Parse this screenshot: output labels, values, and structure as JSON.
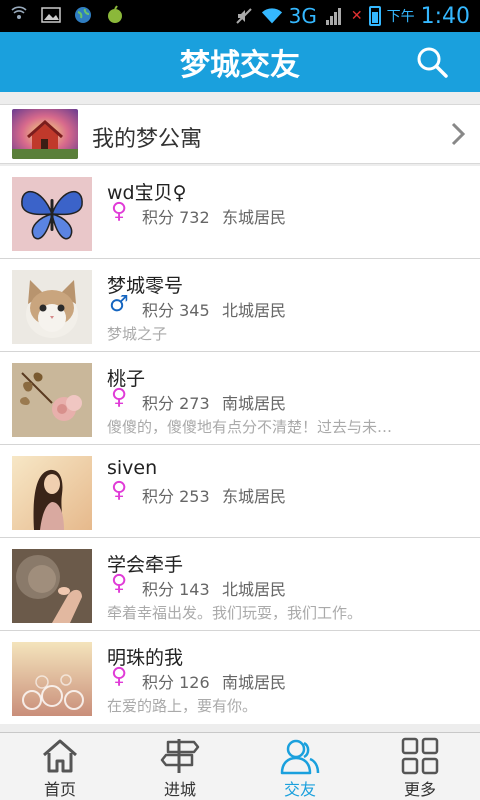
{
  "status_bar": {
    "network": "3G",
    "ampm": "下午",
    "time": "1:40",
    "icons": [
      "wifi-hotspot-icon",
      "image-icon",
      "globe-icon",
      "app-icon",
      "mute-icon",
      "wifi-icon",
      "signal-icon",
      "no-signal-icon",
      "battery-icon"
    ]
  },
  "header": {
    "title": "梦城交友",
    "search_icon": "search-icon"
  },
  "apartment": {
    "label": "我的梦公寓",
    "chevron_icon": "chevron-right-icon"
  },
  "friends": [
    {
      "name": "wd宝贝♀",
      "gender": "♀",
      "gender_type": "female",
      "score": "积分 732",
      "district": "东城居民",
      "bio": ""
    },
    {
      "name": "梦城零号",
      "gender": "♂",
      "gender_type": "male",
      "score": "积分 345",
      "district": "北城居民",
      "bio": "梦城之子"
    },
    {
      "name": "桃子",
      "gender": "♀",
      "gender_type": "female",
      "score": "积分 273",
      "district": "南城居民",
      "bio": "傻傻的，傻傻地有点分不清楚！过去与未…"
    },
    {
      "name": "siven",
      "gender": "♀",
      "gender_type": "female",
      "score": "积分 253",
      "district": "东城居民",
      "bio": ""
    },
    {
      "name": "学会牵手",
      "gender": "♀",
      "gender_type": "female",
      "score": "积分 143",
      "district": "北城居民",
      "bio": "牵着幸福出发。我们玩耍，我们工作。"
    },
    {
      "name": "明珠的我",
      "gender": "♀",
      "gender_type": "female",
      "score": "积分 126",
      "district": "南城居民",
      "bio": "在爱的路上，要有你。"
    }
  ],
  "bottom_nav": [
    {
      "label": "首页",
      "icon": "home-icon",
      "active": false
    },
    {
      "label": "进城",
      "icon": "signpost-icon",
      "active": false
    },
    {
      "label": "交友",
      "icon": "friends-icon",
      "active": true
    },
    {
      "label": "更多",
      "icon": "grid-icon",
      "active": false
    }
  ],
  "colors": {
    "header": "#1aa0dd",
    "accent": "#1aa0dd",
    "female": "#e03bd7",
    "male": "#1565c0",
    "background": "#ededed"
  }
}
